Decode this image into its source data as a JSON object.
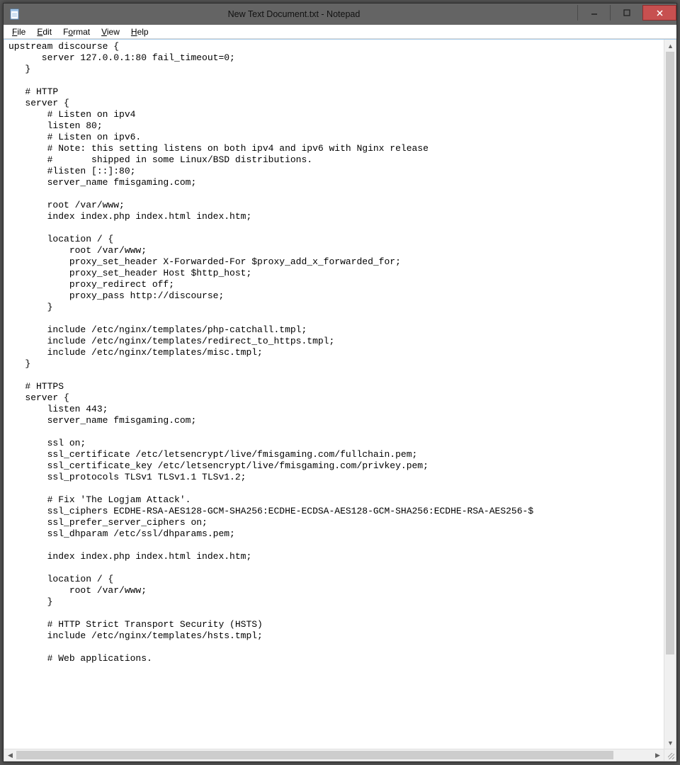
{
  "window": {
    "title": "New Text Document.txt - Notepad"
  },
  "menu": {
    "file": {
      "label": "File",
      "accel": "F"
    },
    "edit": {
      "label": "Edit",
      "accel": "E"
    },
    "format": {
      "label": "Format",
      "accel": "o"
    },
    "view": {
      "label": "View",
      "accel": "V"
    },
    "help": {
      "label": "Help",
      "accel": "H"
    }
  },
  "editor": {
    "content": "upstream discourse {\n      server 127.0.0.1:80 fail_timeout=0;\n   }\n\n   # HTTP\n   server {\n       # Listen on ipv4\n       listen 80;\n       # Listen on ipv6.\n       # Note: this setting listens on both ipv4 and ipv6 with Nginx release\n       #       shipped in some Linux/BSD distributions.\n       #listen [::]:80;\n       server_name fmisgaming.com;\n\n       root /var/www;\n       index index.php index.html index.htm;\n\n       location / {\n           root /var/www;\n           proxy_set_header X-Forwarded-For $proxy_add_x_forwarded_for;\n           proxy_set_header Host $http_host;\n           proxy_redirect off;\n           proxy_pass http://discourse;\n       }\n\n       include /etc/nginx/templates/php-catchall.tmpl;\n       include /etc/nginx/templates/redirect_to_https.tmpl;\n       include /etc/nginx/templates/misc.tmpl;\n   }\n\n   # HTTPS\n   server {\n       listen 443;\n       server_name fmisgaming.com;\n\n       ssl on;\n       ssl_certificate /etc/letsencrypt/live/fmisgaming.com/fullchain.pem;\n       ssl_certificate_key /etc/letsencrypt/live/fmisgaming.com/privkey.pem;\n       ssl_protocols TLSv1 TLSv1.1 TLSv1.2;\n\n       # Fix 'The Logjam Attack'.\n       ssl_ciphers ECDHE-RSA-AES128-GCM-SHA256:ECDHE-ECDSA-AES128-GCM-SHA256:ECDHE-RSA-AES256-$\n       ssl_prefer_server_ciphers on;\n       ssl_dhparam /etc/ssl/dhparams.pem;\n\n       index index.php index.html index.htm;\n\n       location / {\n           root /var/www;\n       }\n\n       # HTTP Strict Transport Security (HSTS)\n       include /etc/nginx/templates/hsts.tmpl;\n\n       # Web applications."
  }
}
